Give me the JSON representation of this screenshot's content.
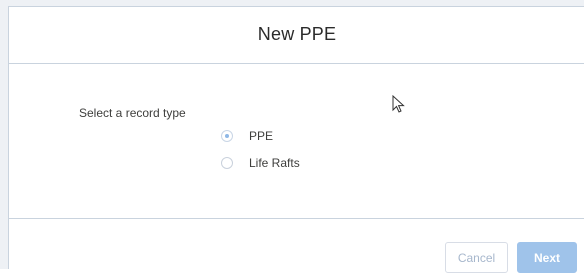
{
  "modal": {
    "title": "New PPE",
    "record_type_label": "Select a record type",
    "options": [
      {
        "label": "PPE",
        "selected": true
      },
      {
        "label": "Life Rafts",
        "selected": false
      }
    ],
    "footer": {
      "cancel_label": "Cancel",
      "next_label": "Next"
    }
  },
  "colors": {
    "border": "#c9d3de",
    "next_button": "#9fc3ea",
    "cancel_text": "#a7b7cc"
  },
  "icons": {
    "cursor": "mouse-pointer-icon"
  }
}
